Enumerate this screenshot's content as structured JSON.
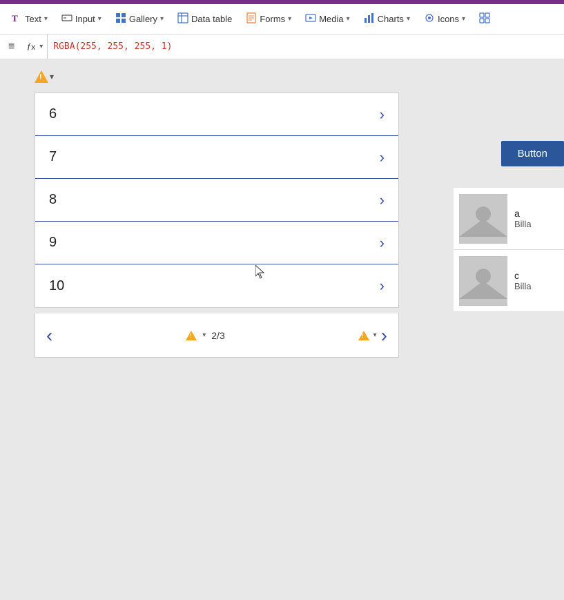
{
  "topbar": {
    "color": "#7B2D8B"
  },
  "toolbar": {
    "items": [
      {
        "id": "text",
        "label": "Text",
        "icon": "text-icon",
        "hasDropdown": true
      },
      {
        "id": "input",
        "label": "Input",
        "icon": "input-icon",
        "hasDropdown": true
      },
      {
        "id": "gallery",
        "label": "Gallery",
        "icon": "gallery-icon",
        "hasDropdown": true
      },
      {
        "id": "datatable",
        "label": "Data table",
        "icon": "datatable-icon",
        "hasDropdown": false
      },
      {
        "id": "forms",
        "label": "Forms",
        "icon": "forms-icon",
        "hasDropdown": true
      },
      {
        "id": "media",
        "label": "Media",
        "icon": "media-icon",
        "hasDropdown": true
      },
      {
        "id": "charts",
        "label": "Charts",
        "icon": "charts-icon",
        "hasDropdown": true
      },
      {
        "id": "icons",
        "label": "Icons",
        "icon": "icons-icon",
        "hasDropdown": true
      },
      {
        "id": "components",
        "label": "",
        "icon": "components-icon",
        "hasDropdown": false
      }
    ]
  },
  "formula_bar": {
    "menu_label": "≡",
    "fx_label": "fx",
    "chevron_label": "˅",
    "formula_value": "RGBA(255, 255, 255, 1)"
  },
  "list": {
    "rows": [
      {
        "number": "6"
      },
      {
        "number": "7"
      },
      {
        "number": "8"
      },
      {
        "number": "9"
      },
      {
        "number": "10"
      }
    ],
    "chevron": "›"
  },
  "pagination": {
    "left_label": "‹",
    "right_label": "›",
    "page_text": "2/3"
  },
  "button": {
    "label": "Button"
  },
  "image_list": {
    "items": [
      {
        "id": "item-a",
        "label": "a",
        "sublabel": "Billa"
      },
      {
        "id": "item-c",
        "label": "c",
        "sublabel": "Billa"
      }
    ]
  }
}
